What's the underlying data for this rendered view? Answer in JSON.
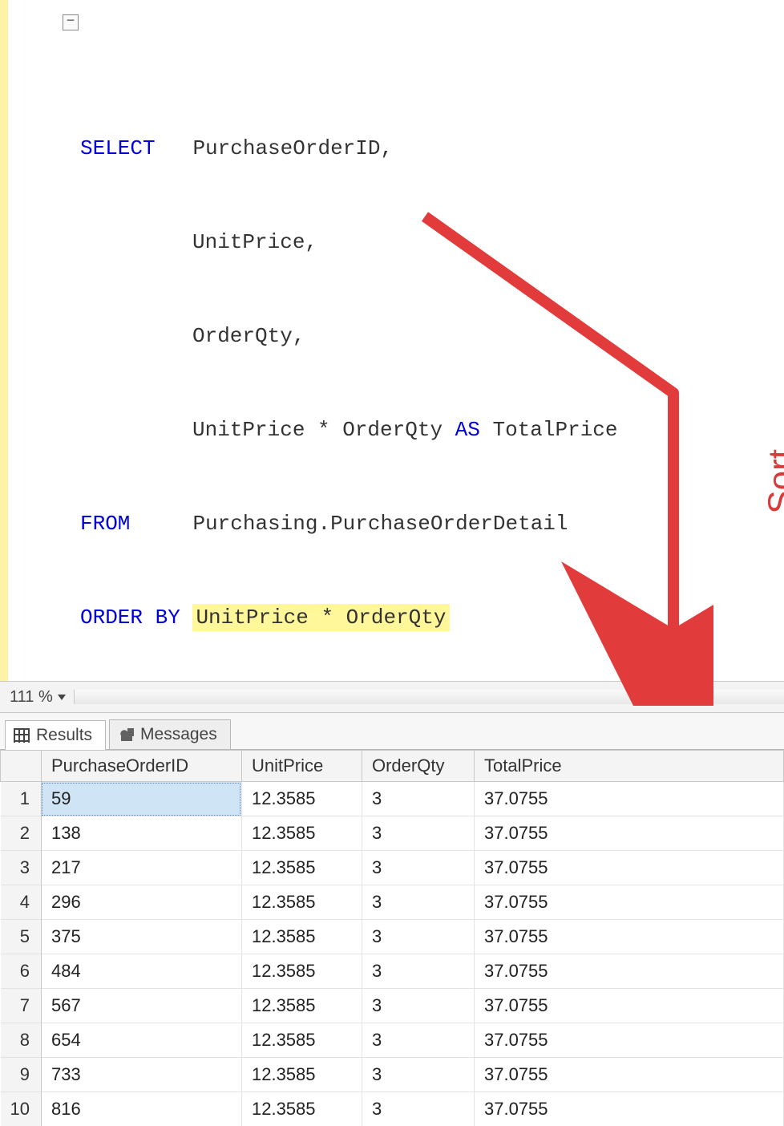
{
  "sql": {
    "select_kw": "SELECT",
    "col1": "PurchaseOrderID,",
    "col2": "UnitPrice,",
    "col3": "OrderQty,",
    "col4a": "UnitPrice * OrderQty ",
    "as_kw": "AS",
    "col4b": " TotalPrice",
    "from_kw": "FROM",
    "from_tbl": "Purchasing.PurchaseOrderDetail",
    "orderby_kw": "ORDER BY",
    "orderby_expr": "UnitPrice * OrderQty",
    "fold_glyph": "−"
  },
  "zoom": {
    "value": "111 %"
  },
  "tabs": {
    "results": "Results",
    "messages": "Messages"
  },
  "grid": {
    "headers": [
      "PurchaseOrderID",
      "UnitPrice",
      "OrderQty",
      "TotalPrice"
    ],
    "rows": [
      {
        "n": "1",
        "c": [
          "59",
          "12.3585",
          "3",
          "37.0755"
        ]
      },
      {
        "n": "2",
        "c": [
          "138",
          "12.3585",
          "3",
          "37.0755"
        ]
      },
      {
        "n": "3",
        "c": [
          "217",
          "12.3585",
          "3",
          "37.0755"
        ]
      },
      {
        "n": "4",
        "c": [
          "296",
          "12.3585",
          "3",
          "37.0755"
        ]
      },
      {
        "n": "5",
        "c": [
          "375",
          "12.3585",
          "3",
          "37.0755"
        ]
      },
      {
        "n": "6",
        "c": [
          "484",
          "12.3585",
          "3",
          "37.0755"
        ]
      },
      {
        "n": "7",
        "c": [
          "567",
          "12.3585",
          "3",
          "37.0755"
        ]
      },
      {
        "n": "8",
        "c": [
          "654",
          "12.3585",
          "3",
          "37.0755"
        ]
      },
      {
        "n": "9",
        "c": [
          "733",
          "12.3585",
          "3",
          "37.0755"
        ]
      },
      {
        "n": "10",
        "c": [
          "816",
          "12.3585",
          "3",
          "37.0755"
        ]
      }
    ]
  },
  "annotation": {
    "sort_label": "Sort"
  }
}
